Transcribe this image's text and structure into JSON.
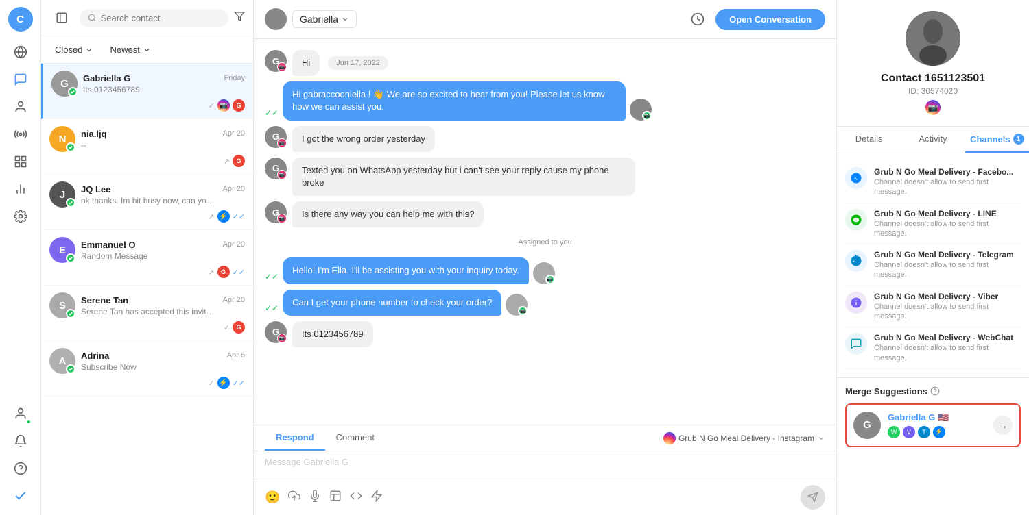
{
  "app": {
    "user_initial": "C"
  },
  "nav": {
    "items": [
      {
        "id": "dashboard",
        "icon": "⊙",
        "label": "dashboard"
      },
      {
        "id": "chat",
        "icon": "💬",
        "label": "conversations",
        "active": true
      },
      {
        "id": "contacts",
        "icon": "👤",
        "label": "contacts"
      },
      {
        "id": "broadcast",
        "icon": "📡",
        "label": "broadcast"
      },
      {
        "id": "integrations",
        "icon": "⊞",
        "label": "integrations"
      },
      {
        "id": "analytics",
        "icon": "📊",
        "label": "analytics"
      },
      {
        "id": "settings",
        "icon": "⚙",
        "label": "settings"
      }
    ],
    "bottom_items": [
      {
        "id": "profile",
        "icon": "👤",
        "label": "profile"
      },
      {
        "id": "notifications",
        "icon": "🔔",
        "label": "notifications"
      },
      {
        "id": "help",
        "icon": "?",
        "label": "help"
      },
      {
        "id": "checkmark",
        "icon": "✓",
        "label": "status"
      }
    ]
  },
  "contacts_panel": {
    "search_placeholder": "Search contact",
    "filter_label": "Closed",
    "sort_label": "Newest",
    "contacts": [
      {
        "id": "1",
        "name": "Gabriella G",
        "preview": "Its 0123456789",
        "date": "Friday",
        "avatar_bg": "#a0a0a0",
        "initial": "G",
        "active": true,
        "badges": [
          "ig",
          "gmail_check"
        ]
      },
      {
        "id": "2",
        "name": "nia.ljq",
        "preview": "--",
        "date": "Apr 20",
        "avatar_bg": "#f5a623",
        "initial": "N",
        "active": false,
        "badges": [
          "arrow_up",
          "gmail"
        ]
      },
      {
        "id": "3",
        "name": "JQ Lee",
        "preview": "ok thanks. Im bit busy now, can you do the simple sign up for me...",
        "date": "Apr 20",
        "avatar_bg": "#555",
        "initial": "J",
        "active": false,
        "badges": [
          "messenger",
          "double_check"
        ]
      },
      {
        "id": "4",
        "name": "Emmanuel O",
        "preview": "Random Message",
        "date": "Apr 20",
        "avatar_bg": "#7b68ee",
        "initial": "E",
        "active": false,
        "badges": [
          "arrow_up",
          "gmail",
          "double_check"
        ]
      },
      {
        "id": "5",
        "name": "Serene Tan",
        "preview": "Serene Tan has accepted this invitation. HOW TO GET WHATSAPP...",
        "date": "Apr 20",
        "avatar_bg": "#aaa",
        "initial": "S",
        "active": false,
        "badges": [
          "check",
          "gmail"
        ]
      },
      {
        "id": "6",
        "name": "Adrina",
        "preview": "Subscribe Now",
        "date": "Apr 6",
        "avatar_bg": "#aaa",
        "initial": "A",
        "active": false,
        "badges": [
          "check",
          "messenger",
          "double_check"
        ]
      }
    ]
  },
  "conversation": {
    "contact_name": "Gabriella",
    "open_btn_label": "Open Conversation",
    "messages": [
      {
        "id": "1",
        "type": "incoming",
        "text": "Hi",
        "time_label": "Jun 17, 2022"
      },
      {
        "id": "2",
        "type": "outgoing",
        "text": "Hi gabraccooniella ! 👋 We are so excited to hear from you! Please let us know how we can assist you."
      },
      {
        "id": "3",
        "type": "incoming",
        "text": "I got the wrong order yesterday"
      },
      {
        "id": "4",
        "type": "incoming",
        "text": "Texted you on WhatsApp yesterday but i can't see your reply cause my phone broke"
      },
      {
        "id": "5",
        "type": "incoming",
        "text": "Is there any way you can help me with this?"
      },
      {
        "id": "assigned",
        "type": "system",
        "text": "Assigned to you"
      },
      {
        "id": "6",
        "type": "outgoing",
        "text": "Hello! I'm Ella. I'll be assisting you with your inquiry today."
      },
      {
        "id": "7",
        "type": "outgoing",
        "text": "Can I get your phone number to check your order?"
      },
      {
        "id": "8",
        "type": "incoming",
        "text": "Its 0123456789"
      }
    ],
    "reply": {
      "tabs": [
        "Respond",
        "Comment"
      ],
      "active_tab": "Respond",
      "placeholder": "Message Gabriella G",
      "channel": "Grub N Go Meal Delivery - Instagram"
    }
  },
  "right_panel": {
    "contact_name": "Contact 1651123501",
    "contact_id": "ID: 30574020",
    "tabs": [
      {
        "id": "details",
        "label": "Details"
      },
      {
        "id": "activity",
        "label": "Activity"
      },
      {
        "id": "channels",
        "label": "Channels",
        "badge": 1,
        "active": true
      }
    ],
    "channels": [
      {
        "id": "messenger",
        "type": "messenger",
        "name": "Grub N Go Meal Delivery - Facebo...",
        "desc": "Channel doesn't allow to send first message."
      },
      {
        "id": "line",
        "type": "line",
        "name": "Grub N Go Meal Delivery - LINE",
        "desc": "Channel doesn't allow to send first message."
      },
      {
        "id": "telegram",
        "type": "telegram",
        "name": "Grub N Go Meal Delivery - Telegram",
        "desc": "Channel doesn't allow to send first message."
      },
      {
        "id": "viber",
        "type": "viber",
        "name": "Grub N Go Meal Delivery - Viber",
        "desc": "Channel doesn't allow to send first message."
      },
      {
        "id": "webchat",
        "type": "webchat",
        "name": "Grub N Go Meal Delivery - WebChat",
        "desc": "Channel doesn't allow to send first message."
      }
    ],
    "merge_suggestions": {
      "label": "Merge Suggestions",
      "contact": {
        "name": "Gabriella G 🇺🇸",
        "channels": [
          "whatsapp",
          "viber",
          "telegram",
          "messenger"
        ]
      }
    }
  }
}
